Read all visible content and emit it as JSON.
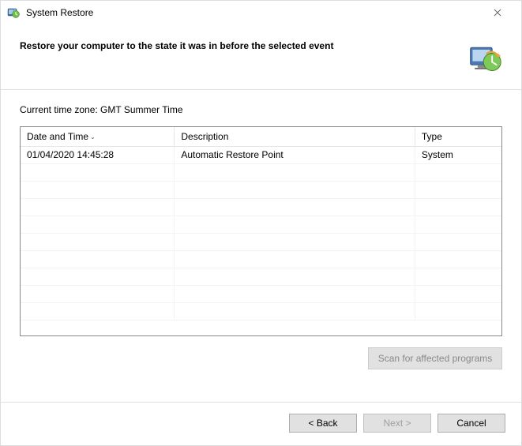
{
  "titlebar": {
    "title": "System Restore"
  },
  "header": {
    "title": "Restore your computer to the state it was in before the selected event"
  },
  "content": {
    "timezone_label": "Current time zone: GMT Summer Time",
    "columns": {
      "datetime": "Date and Time",
      "description": "Description",
      "type": "Type"
    },
    "rows": [
      {
        "datetime": "01/04/2020 14:45:28",
        "description": "Automatic Restore Point",
        "type": "System"
      }
    ],
    "scan_button": "Scan for affected programs"
  },
  "footer": {
    "back": "< Back",
    "next": "Next >",
    "cancel": "Cancel"
  }
}
